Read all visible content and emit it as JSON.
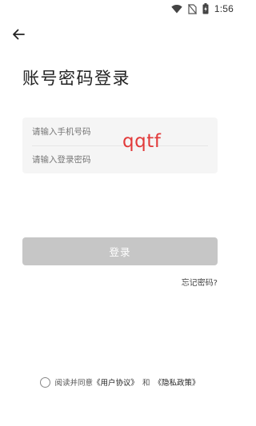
{
  "status_bar": {
    "time": "1:56",
    "icons": [
      "wifi-icon",
      "no-sim-icon",
      "battery-charging-icon"
    ]
  },
  "header": {
    "back_icon": "arrow-left-icon",
    "title": "账号密码登录"
  },
  "form": {
    "phone_placeholder": "请输入手机号码",
    "password_placeholder": "请输入登录密码",
    "overlay_text": "qqtf",
    "overlay_color": "#e23a3a"
  },
  "actions": {
    "login_label": "登录",
    "login_bg": "#c6c6c6",
    "forgot_label": "忘记密码?"
  },
  "agreement": {
    "checked": false,
    "prefix": "阅读并同意",
    "user_agreement": "《用户协议》",
    "conjunction": "和",
    "privacy_policy": "《隐私政策》"
  }
}
